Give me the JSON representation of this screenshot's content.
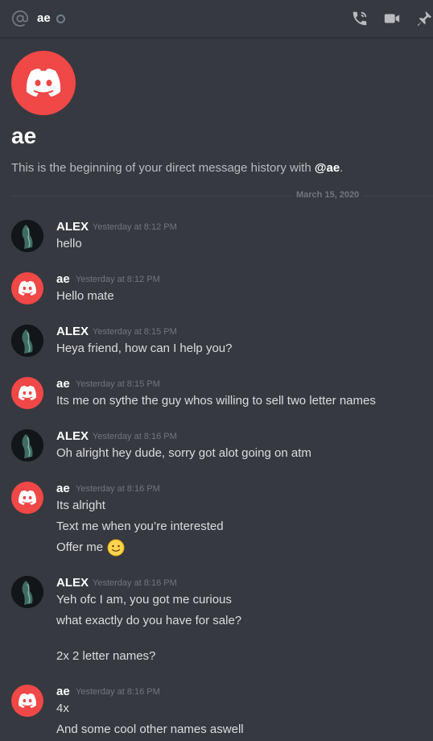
{
  "header": {
    "name": "ae",
    "at_icon": "at-icon",
    "status": "offline",
    "icons": [
      "call-icon",
      "video-icon",
      "pin-icon"
    ]
  },
  "intro": {
    "name": "ae",
    "text_prefix": "This is the beginning of your direct message history with ",
    "mention": "@ae",
    "text_suffix": "."
  },
  "divider": {
    "date": "March 15, 2020"
  },
  "colors": {
    "brand": "#f04747",
    "background": "#36393f"
  },
  "messages": [
    {
      "author": "ALEX",
      "timestamp": "Yesterday at 8:12 PM",
      "lines": [
        "hello"
      ]
    },
    {
      "author": "ae",
      "timestamp": "Yesterday at 8:12 PM",
      "lines": [
        "Hello mate"
      ]
    },
    {
      "author": "ALEX",
      "timestamp": "Yesterday at 8:15 PM",
      "lines": [
        "Heya friend, how can I help you?"
      ]
    },
    {
      "author": "ae",
      "timestamp": "Yesterday at 8:15 PM",
      "lines": [
        "Its me on sythe the guy whos willing to sell two letter names"
      ]
    },
    {
      "author": "ALEX",
      "timestamp": "Yesterday at 8:16 PM",
      "lines": [
        "Oh alright hey dude, sorry got alot going on atm"
      ]
    },
    {
      "author": "ae",
      "timestamp": "Yesterday at 8:16 PM",
      "lines": [
        "Its alright",
        "Text me when you’re interested",
        "Offer me"
      ],
      "emoji": "slightly-smiling-face"
    },
    {
      "author": "ALEX",
      "timestamp": "Yesterday at 8:16 PM",
      "lines": [
        "Yeh ofc I am, you got me curious",
        "what exactly do you have for sale?",
        "2x 2 letter names?"
      ]
    },
    {
      "author": "ae",
      "timestamp": "Yesterday at 8:16 PM",
      "lines": [
        "4x",
        "And some cool other names aswell"
      ]
    }
  ]
}
